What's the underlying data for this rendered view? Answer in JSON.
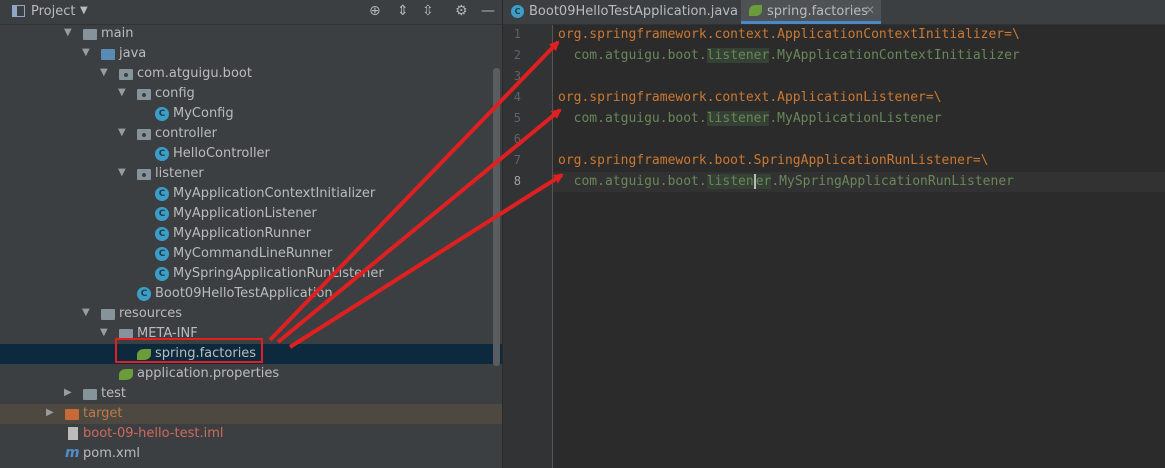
{
  "project_panel": {
    "title": "Project",
    "tree": [
      {
        "label": "main",
        "icon": "folder-icon"
      },
      {
        "label": "java",
        "icon": "source-folder-icon"
      },
      {
        "label": "com.atguigu.boot",
        "icon": "package-icon"
      },
      {
        "label": "config",
        "icon": "package-icon"
      },
      {
        "label": "MyConfig",
        "icon": "class-icon"
      },
      {
        "label": "controller",
        "icon": "package-icon"
      },
      {
        "label": "HelloController",
        "icon": "class-icon"
      },
      {
        "label": "listener",
        "icon": "package-icon"
      },
      {
        "label": "MyApplicationContextInitializer",
        "icon": "class-icon"
      },
      {
        "label": "MyApplicationListener",
        "icon": "class-icon"
      },
      {
        "label": "MyApplicationRunner",
        "icon": "class-icon"
      },
      {
        "label": "MyCommandLineRunner",
        "icon": "class-icon"
      },
      {
        "label": "MySpringApplicationRunListener",
        "icon": "class-icon"
      },
      {
        "label": "Boot09HelloTestApplication",
        "icon": "spring-boot-class-icon"
      },
      {
        "label": "resources",
        "icon": "resources-folder-icon"
      },
      {
        "label": "META-INF",
        "icon": "folder-icon"
      },
      {
        "label": "spring.factories",
        "icon": "spring-icon"
      },
      {
        "label": "application.properties",
        "icon": "spring-icon"
      },
      {
        "label": "test",
        "icon": "folder-icon"
      },
      {
        "label": "target",
        "icon": "excluded-folder-icon"
      },
      {
        "label": "boot-09-hello-test.iml",
        "icon": "module-file-icon"
      },
      {
        "label": "pom.xml",
        "icon": "maven-icon"
      }
    ]
  },
  "editor": {
    "tabs": [
      {
        "label": "Boot09HelloTestApplication.java"
      },
      {
        "label": "spring.factories",
        "active": true
      }
    ],
    "line_numbers": [
      "1",
      "2",
      "3",
      "4",
      "5",
      "6",
      "7",
      "8"
    ],
    "current_line": 8,
    "lines": [
      {
        "key": "org.springframework.context.ApplicationContextInitializer",
        "sep": "=\\"
      },
      {
        "prefix": "  com.atguigu.boot.",
        "pkg": "listener",
        "suffix": ".MyApplicationContextInitializer"
      },
      {},
      {
        "key": "org.springframework.context.ApplicationListener",
        "sep": "=\\"
      },
      {
        "prefix": "  com.atguigu.boot.",
        "pkg": "listener",
        "suffix": ".MyApplicationListener"
      },
      {},
      {
        "key": "org.springframework.boot.SpringApplicationRunListener",
        "sep": "=\\"
      },
      {
        "prefix": "  com.atguigu.boot.",
        "pkg_a": "listen",
        "pkg_b": "er",
        "suffix": ".MySpringApplicationRunListener"
      }
    ]
  },
  "colors": {
    "key": "#cc7832",
    "value": "#6a8759",
    "annotation": "#e02020",
    "selection": "#0d293e",
    "target_bg": "#4d4840",
    "target_text": "#c07a4a",
    "iml_text": "#d0695b"
  }
}
